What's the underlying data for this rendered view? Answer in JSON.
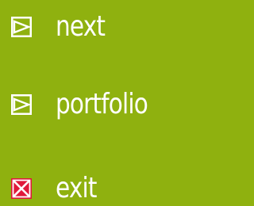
{
  "menu": {
    "items": [
      {
        "label": "next",
        "icon": "play-box-icon",
        "icon_color": "#ffffff"
      },
      {
        "label": "portfolio",
        "icon": "play-box-icon",
        "icon_color": "#ffffff"
      },
      {
        "label": "exit",
        "icon": "close-box-icon",
        "icon_color": "#e0183a",
        "icon_mark_color": "#ffffff"
      }
    ]
  },
  "colors": {
    "background": "#8fb10f",
    "text": "#ffffff",
    "exit_accent": "#e0183a"
  }
}
